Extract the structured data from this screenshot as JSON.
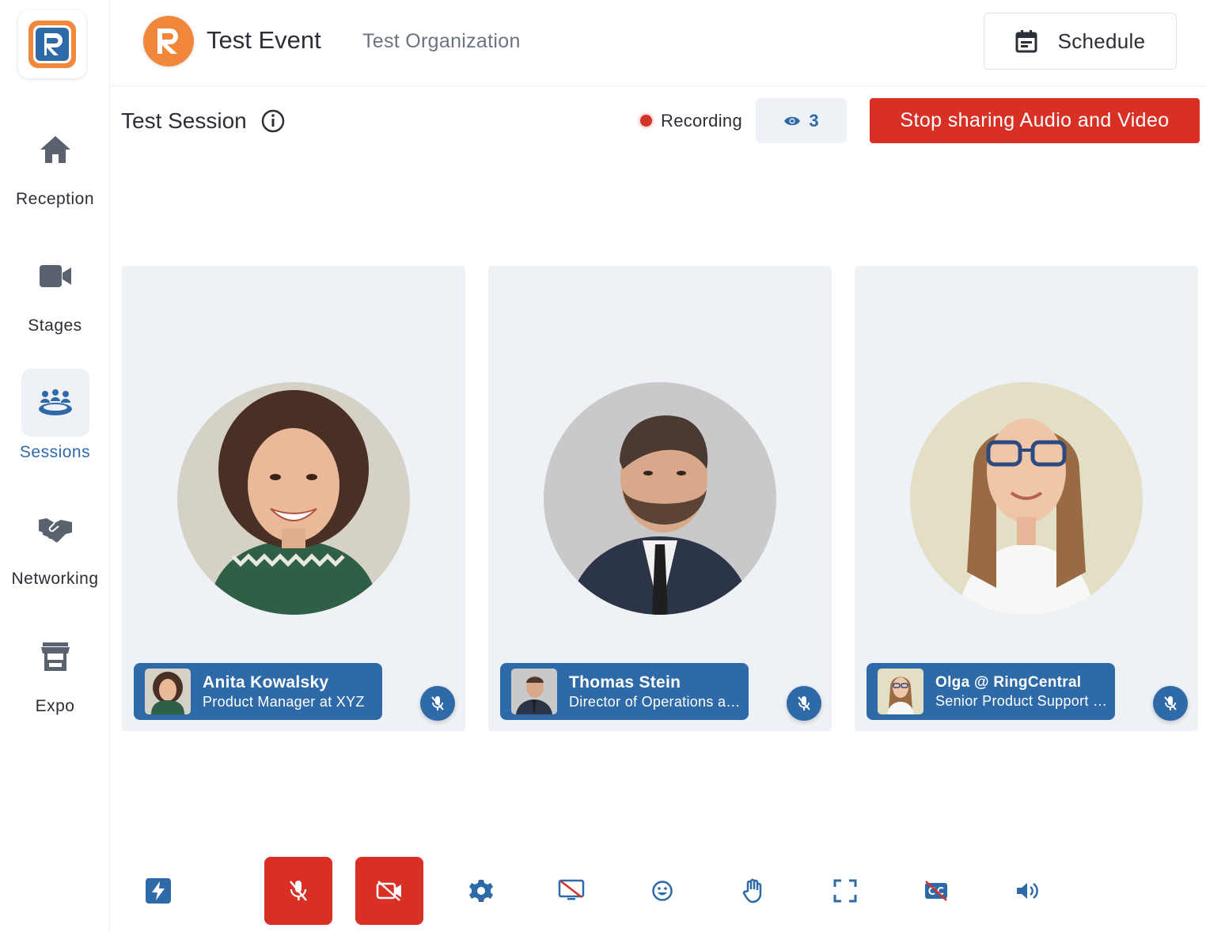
{
  "app": {
    "logo_icon": "ringcentral-r-logo"
  },
  "sidebar": {
    "items": [
      {
        "label": "Reception",
        "icon": "home-icon",
        "active": false
      },
      {
        "label": "Stages",
        "icon": "video-camera-icon",
        "active": false
      },
      {
        "label": "Sessions",
        "icon": "group-table-icon",
        "active": true
      },
      {
        "label": "Networking",
        "icon": "handshake-icon",
        "active": false
      },
      {
        "label": "Expo",
        "icon": "booth-icon",
        "active": false
      }
    ]
  },
  "header": {
    "event_title": "Test Event",
    "organization": "Test Organization",
    "schedule_label": "Schedule"
  },
  "session": {
    "title": "Test Session",
    "recording_label": "Recording",
    "viewer_count": "3",
    "stop_button_label": "Stop sharing Audio and Video"
  },
  "participants": [
    {
      "name": "Anita Kowalsky",
      "subtitle": "Product Manager at XYZ",
      "muted": true
    },
    {
      "name": "Thomas Stein",
      "subtitle": "Director of Operations at ...",
      "muted": true
    },
    {
      "name": "Olga @ RingCentral",
      "subtitle": "Senior Product Support R...",
      "muted": true
    }
  ],
  "toolbar": {
    "tools": [
      "lightning-icon",
      "mic-off-icon",
      "camera-off-icon",
      "settings-icon",
      "screen-share-off-icon",
      "emoji-icon",
      "raise-hand-icon",
      "fullscreen-icon",
      "captions-off-icon",
      "speaker-icon"
    ]
  },
  "colors": {
    "accent": "#2f6aa8",
    "danger": "#d93025",
    "brand_orange": "#f0873a",
    "tile_bg": "#eef2f7"
  }
}
